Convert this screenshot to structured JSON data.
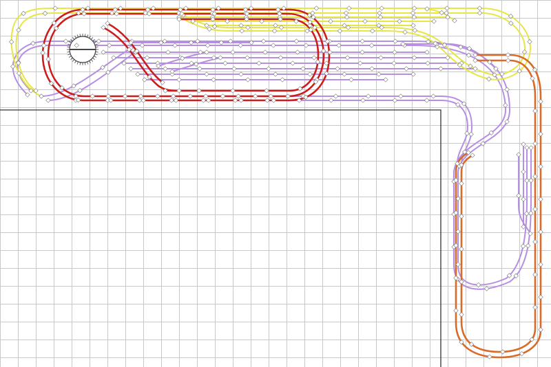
{
  "canvas": {
    "background": "#ffffff",
    "grid_color": "#c8c8c8",
    "grid_spacing": 26,
    "boundary_color": "#333333"
  },
  "colors": {
    "yellow": "#e6e645",
    "red": "#cc1c1c",
    "purple": "#b68ee3",
    "orange": "#d86b28",
    "joint_fill": "#ffffff",
    "joint_stroke": "#777777",
    "turntable": "#444444"
  },
  "turntable": {
    "icon": "turntable-icon"
  },
  "track_layers": [
    "yellow",
    "red",
    "purple",
    "orange"
  ]
}
